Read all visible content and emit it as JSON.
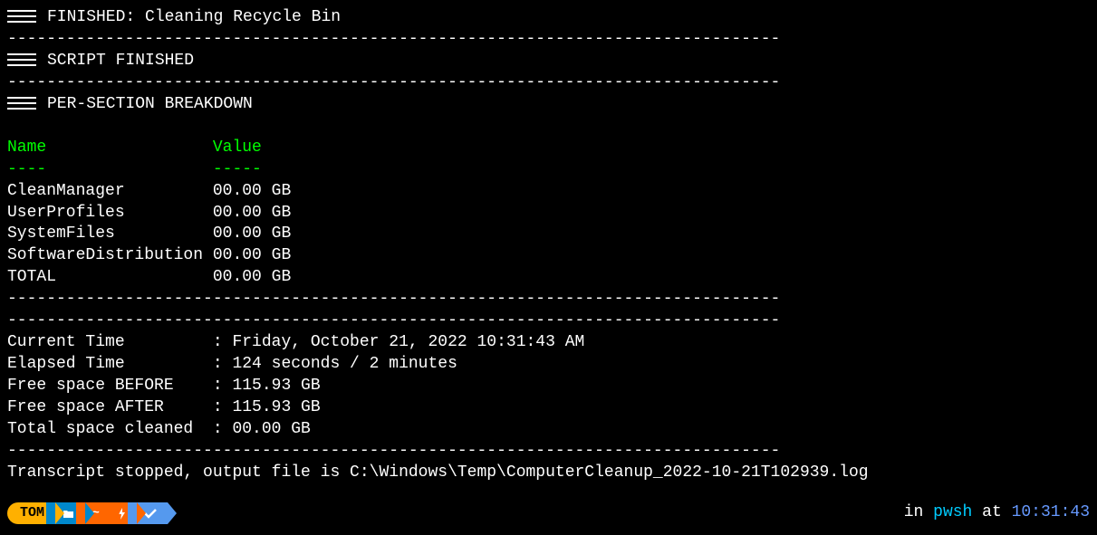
{
  "output": {
    "finished_task": "FINISHED: Cleaning Recycle Bin",
    "divider": "-------------------------------------------------------------------------------",
    "script_finished": "SCRIPT FINISHED",
    "breakdown_header": "PER-SECTION BREAKDOWN",
    "table": {
      "headers": {
        "name": "Name",
        "value": "Value"
      },
      "header_underline": {
        "name": "----",
        "value": "-----"
      },
      "rows": [
        {
          "name": "CleanManager",
          "value": "00.00 GB"
        },
        {
          "name": "UserProfiles",
          "value": "00.00 GB"
        },
        {
          "name": "SystemFiles",
          "value": "00.00 GB"
        },
        {
          "name": "SoftwareDistribution",
          "value": "00.00 GB"
        },
        {
          "name": "TOTAL",
          "value": "00.00 GB"
        }
      ]
    },
    "stats": [
      {
        "label": "Current Time",
        "value": "Friday, October 21, 2022 10:31:43 AM"
      },
      {
        "label": "Elapsed Time",
        "value": "124 seconds / 2 minutes"
      },
      {
        "label": "Free space BEFORE",
        "value": "115.93 GB"
      },
      {
        "label": "Free space AFTER",
        "value": "115.93 GB"
      },
      {
        "label": "Total space cleaned",
        "value": "00.00 GB"
      }
    ],
    "transcript": "Transcript stopped, output file is C:\\Windows\\Temp\\ComputerCleanup_2022-10-21T102939.log"
  },
  "prompt": {
    "user": "TOM",
    "right": {
      "prefix": "in ",
      "shell": "pwsh",
      "middle": " at ",
      "time": "10:31:43"
    }
  }
}
